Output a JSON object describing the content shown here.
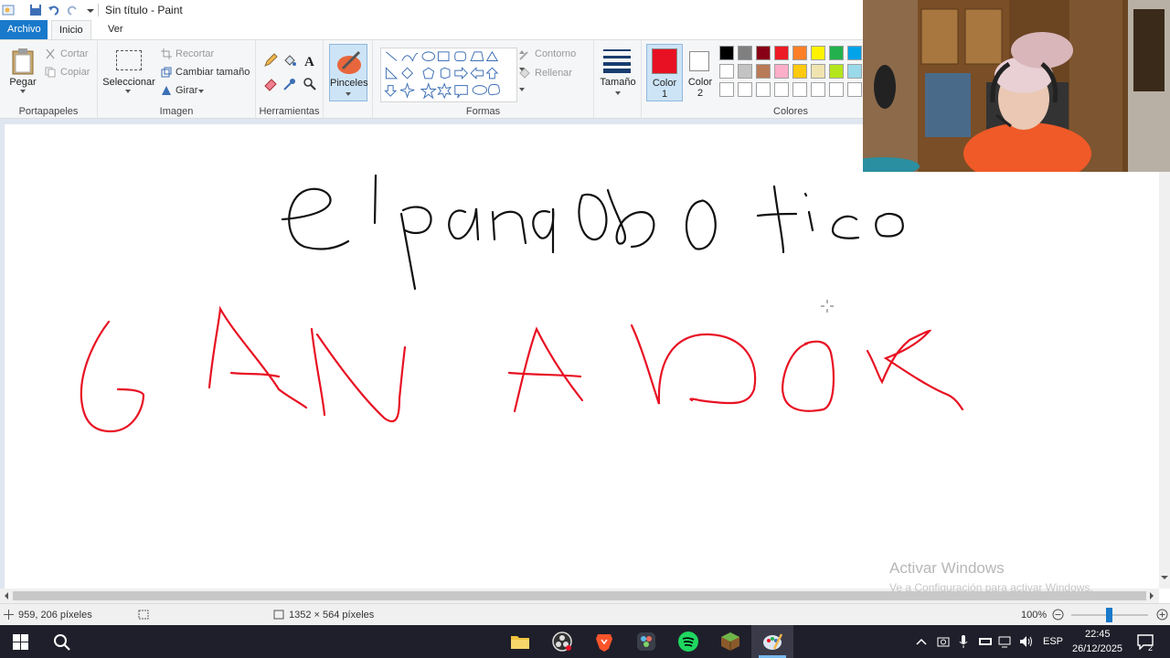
{
  "window": {
    "title": "Sin título - Paint"
  },
  "menu": {
    "file": "Archivo",
    "home": "Inicio",
    "view": "Ver"
  },
  "ribbon": {
    "clipboard": {
      "paste": "Pegar",
      "cut": "Cortar",
      "copy": "Copiar",
      "label": "Portapapeles"
    },
    "image": {
      "select": "Seleccionar",
      "crop": "Recortar",
      "resize": "Cambiar tamaño",
      "rotate": "Girar",
      "label": "Imagen"
    },
    "tools": {
      "label": "Herramientas"
    },
    "brushes": {
      "label": "Pinceles"
    },
    "shapes": {
      "outline": "Contorno",
      "fill": "Rellenar",
      "label": "Formas"
    },
    "size": {
      "label": "Tamaño"
    },
    "color1": {
      "label_line1": "Color",
      "label_line2": "1",
      "value": "#e81123"
    },
    "color2": {
      "label_line1": "Color",
      "label_line2": "2",
      "value": "#ffffff"
    },
    "colors": {
      "label": "Colores",
      "palette_row1": [
        "#000000",
        "#7f7f7f",
        "#880015",
        "#ed1c24",
        "#ff7f27",
        "#fff200",
        "#22b14c",
        "#00a2e8"
      ],
      "palette_row2": [
        "#ffffff",
        "#c3c3c3",
        "#b97a57",
        "#ffaec9",
        "#ffc90e",
        "#efe4b0",
        "#b5e61d",
        "#99d9ea"
      ]
    }
  },
  "canvas": {
    "handwriting_black": "el panaroso tico",
    "handwriting_red": "GANADOR"
  },
  "status": {
    "cursor_pos": "959, 206 píxeles",
    "canvas_size": "1352 × 564 píxeles",
    "zoom": "100%"
  },
  "watermark": {
    "title": "Activar Windows",
    "subtitle": "Ve a Configuración para activar Windows."
  },
  "taskbar": {
    "lang": "ESP",
    "time": "22:45",
    "date": "26/12/2025",
    "notifications": "2"
  }
}
